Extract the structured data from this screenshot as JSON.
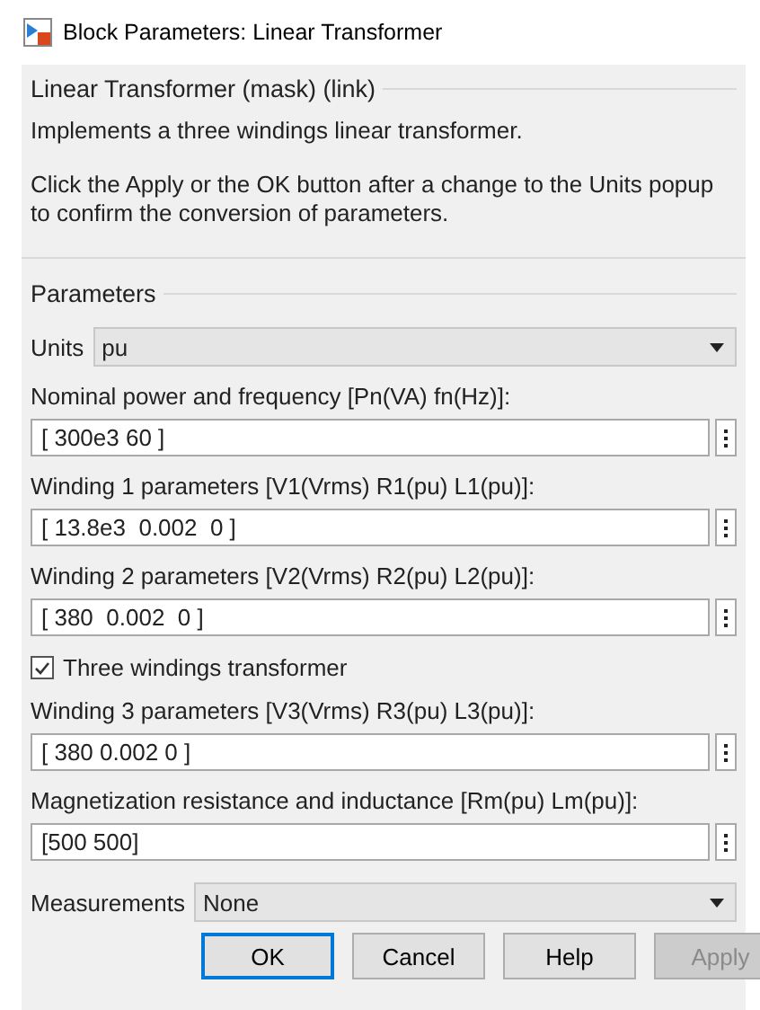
{
  "window": {
    "title": "Block Parameters: Linear Transformer"
  },
  "description": {
    "title": "Linear Transformer (mask) (link)",
    "paragraphs": [
      "Implements a three windings linear transformer.",
      "Click the Apply or the OK button after a change to the Units popup to confirm the conversion of parameters."
    ]
  },
  "parameters": {
    "title": "Parameters",
    "items": [
      {
        "kind": "dropdown",
        "label": "Units",
        "value": "pu"
      },
      {
        "kind": "field",
        "label": "Nominal power and frequency [Pn(VA) fn(Hz)]:",
        "value": "[ 300e3 60 ]"
      },
      {
        "kind": "field",
        "label": "Winding 1 parameters [V1(Vrms) R1(pu) L1(pu)]:",
        "value": "[ 13.8e3  0.002  0 ]"
      },
      {
        "kind": "field",
        "label": "Winding 2 parameters [V2(Vrms) R2(pu) L2(pu)]:",
        "value": "[ 380  0.002  0 ]"
      },
      {
        "kind": "checkbox",
        "label": "Three windings transformer",
        "checked": true
      },
      {
        "kind": "field",
        "label": "Winding 3 parameters [V3(Vrms) R3(pu) L3(pu)]:",
        "value": "[ 380 0.002 0 ]"
      },
      {
        "kind": "field",
        "label": "Magnetization resistance and inductance [Rm(pu) Lm(pu)]:",
        "value": "[500 500]"
      },
      {
        "kind": "dropdown",
        "label": "Measurements",
        "value": "None"
      }
    ]
  },
  "buttons": [
    {
      "label": "OK",
      "focused": true,
      "disabled": false
    },
    {
      "label": "Cancel",
      "focused": false,
      "disabled": false
    },
    {
      "label": "Help",
      "focused": false,
      "disabled": false
    },
    {
      "label": "Apply",
      "focused": false,
      "disabled": true
    }
  ]
}
